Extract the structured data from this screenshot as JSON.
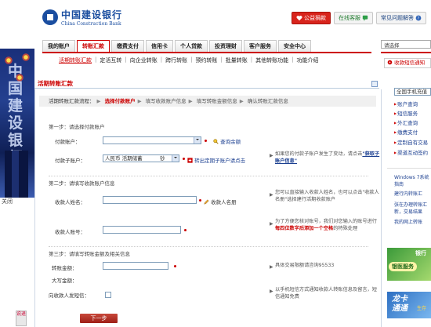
{
  "header": {
    "logo_cn": "中国建设银行",
    "logo_en": "China Construction Bank",
    "buttons": [
      {
        "label": "公益捐款",
        "icon": "heart-icon",
        "style": "red"
      },
      {
        "label": "在线客服",
        "icon": "chat-icon",
        "style": "green"
      },
      {
        "label": "常见问题解答",
        "icon": "help-icon",
        "style": "blue"
      }
    ]
  },
  "nav": {
    "tabs": [
      {
        "label": "我的账户",
        "active": false
      },
      {
        "label": "转账汇款",
        "active": true
      },
      {
        "label": "缴费支付",
        "active": false
      },
      {
        "label": "信用卡",
        "active": false
      },
      {
        "label": "个人贷款",
        "active": false
      },
      {
        "label": "投资理财",
        "active": false
      },
      {
        "label": "客户服务",
        "active": false
      },
      {
        "label": "安全中心",
        "active": false
      }
    ],
    "subnav": [
      "活期转账汇款",
      "定活互转",
      "向企业转账",
      "跨行转账",
      "预约转账",
      "批量转账",
      "其他转账功能",
      "功能介绍"
    ]
  },
  "panel": {
    "title": "活期转账汇款",
    "process_label": "活期转账汇款流程：",
    "process_steps": [
      "选择付款账户",
      "填写收款账户信息",
      "填写转账金额信息",
      "确认转账汇款信息"
    ],
    "step1": {
      "heading": "第一步：请选择付款账户",
      "payer_label": "付款账户：",
      "balance_link": "查询余额",
      "sub_label": "付款子账户：",
      "sub_currency": "人民币 活期储蓄",
      "sub_type": "钞",
      "transfer_link": "转出定期子账户请点击",
      "hint": "如果您的付款子账户发生了变动，请点击",
      "hint_link": "\"获取子账户信息\""
    },
    "step2": {
      "heading": "第二步：请填写收款账户信息",
      "name_label": "收款人姓名：",
      "payee_book_link": "收款人名册",
      "name_hint": "您可以直接输入收款人姓名，也可以点击\"收款人名册\"选择建行活期收款账户",
      "account_label": "收款人账号：",
      "account_hint_pre": "为了方便您核对账号，我们对您输入的账号进行",
      "account_hint_bold": "每四位数字后添加一个空格",
      "account_hint_post": "的特殊处理"
    },
    "step3": {
      "heading": "第三步：请填写转账金额及相关信息",
      "amount_label": "转账金额：",
      "amount_hint": "具体交易限额请咨询95533",
      "uppercase_label": "大写金额：",
      "sms_label": "向收款人发短信：",
      "sms_hint": "以手机短信方式通知收款人转账信息及留言，短信通知免费"
    },
    "next_button": "下一步"
  },
  "left_banner": {
    "close_label": "关闭",
    "side_tab": "说退"
  },
  "right_sidebar": {
    "search_placeholder": "请选择",
    "top_box": "收款短信通知",
    "select_value": "全国手机充值",
    "quick_links": [
      "账户查询",
      "短信服务",
      "外汇查询",
      "缴费支付",
      "定制自有交易",
      "渠道互动签约"
    ],
    "news": [
      "Windows 7系统",
      "指南",
      "建行内转账汇",
      "张在办理转账汇",
      "新，交易结果",
      "我的网上转账"
    ],
    "ad1_text": "银医服务",
    "ad1_corner": "银行",
    "ad2_text": "龙卡",
    "ad2_text2": "通通",
    "ad2_corner": "生存"
  },
  "colors": {
    "accent": "#cc0000",
    "link": "#1b3f90",
    "brand": "#1b4ea0"
  }
}
